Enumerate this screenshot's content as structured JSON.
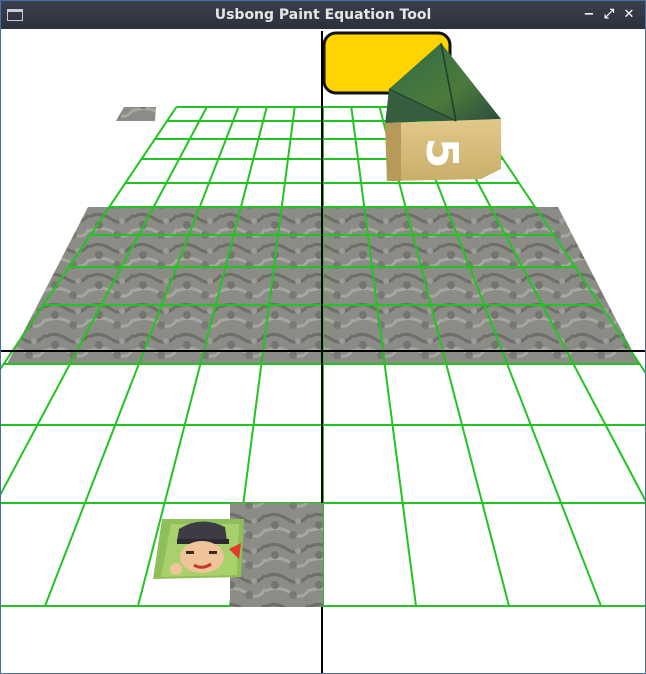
{
  "window": {
    "title": "Usbong Paint Equation Tool",
    "controls": {
      "minimize": "−",
      "restore": "⤢",
      "close": "✕"
    }
  },
  "scene": {
    "grid_color": "#22c422",
    "axis_color": "#000000",
    "stone_color": "#8a8a84",
    "yellow_panel_color": "#ffd400",
    "cube": {
      "face_text": "5",
      "top_color": "#3f6b3c",
      "side_color": "#d7bb74"
    },
    "avatar": "pixel-character-icon"
  }
}
